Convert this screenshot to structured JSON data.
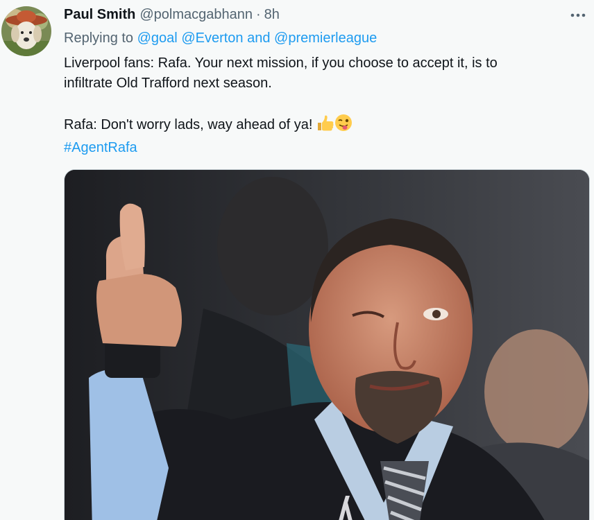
{
  "tweet": {
    "author_name": "Paul Smith",
    "author_handle": "@polmacgabhann",
    "separator": "·",
    "timestamp": "8h",
    "reply_prefix": "Replying to",
    "reply_mention_1": "@goal",
    "reply_mention_2": "@Everton",
    "reply_and": "and",
    "reply_mention_3": "@premierleague",
    "text_line_1": "Liverpool fans: Rafa. Your next mission, if you choose to accept it, is to",
    "text_line_2": "infiltrate Old Trafford next season.",
    "text_line_3": "Rafa: Don't worry lads, way ahead of ya!",
    "hashtag": "#AgentRafa"
  },
  "icons": {
    "more": "more-horizontal-icon",
    "emoji_1": "thumbs-up-emoji",
    "emoji_2": "winking-face-with-tongue-emoji"
  },
  "colors": {
    "link": "#1d9bf0",
    "secondary_text": "#536471",
    "primary_text": "#0f1419",
    "background": "#f7f9f9"
  }
}
